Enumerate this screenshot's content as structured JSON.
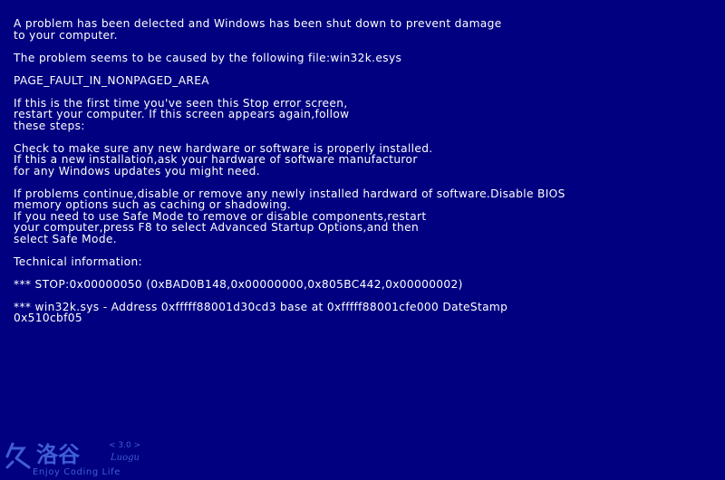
{
  "colors": {
    "background": "#000080",
    "text": "#ffffff",
    "watermark": "#3f5dd6"
  },
  "paragraphs": [
    [
      "A problem has been delected and Windows has been shut down to prevent damage",
      "to your computer."
    ],
    [
      "The problem seems to be caused by the following file:win32k.esys"
    ],
    [
      "PAGE_FAULT_IN_NONPAGED_AREA"
    ],
    [
      "If this is the first time you've seen this Stop error screen,",
      "restart your computer. If this screen appears again,follow",
      "these steps:"
    ],
    [
      "Check to make sure any new hardware or software is properly installed.",
      "If this a new installation,ask your hardware of software manufacturor",
      "for any Windows updates you might need."
    ],
    [
      "If problems continue,disable or remove any newly installed hardward of software.Disable BIOS",
      "memory options such as caching or shadowing.",
      "If you need to use Safe Mode to remove or disable components,restart",
      "your computer,press F8 to select Advanced Startup Options,and then",
      "select Safe Mode."
    ],
    [
      "Technical information:"
    ],
    [
      "*** STOP:0x00000050 (0xBAD0B148,0x00000000,0x805BC442,0x00000002)"
    ],
    [
      "*** win32k.sys - Address 0xfffff88001d30cd3 base at 0xfffff88001cfe000 DateStamp",
      "0x510cbf05"
    ]
  ],
  "watermark": {
    "logo_text": "洛谷",
    "version": "< 3.0 >",
    "brand": "Luogu",
    "tagline": "Enjoy Coding Life"
  }
}
